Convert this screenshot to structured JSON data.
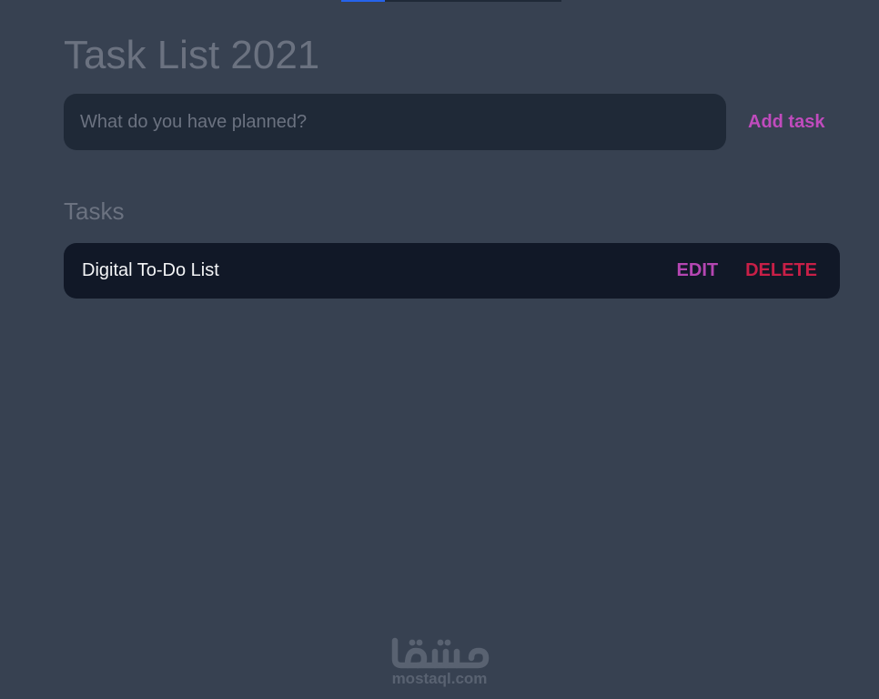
{
  "top_indicator": {
    "progress": 0.2
  },
  "header": {
    "title": "Task List 2021"
  },
  "new_task": {
    "placeholder": "What do you have planned?",
    "value": "",
    "add_label": "Add task"
  },
  "tasks": {
    "heading": "Tasks",
    "items": [
      {
        "text": "Digital To-Do List",
        "edit_label": "EDIT",
        "delete_label": "DELETE"
      }
    ]
  },
  "watermark": {
    "logo_text": "مستقل",
    "domain": "mostaql.com"
  },
  "colors": {
    "background": "#374151",
    "input_bg": "#1f2937",
    "task_bg": "#111827",
    "accent": "#c04bbd",
    "danger": "#c81f47",
    "muted_text": "#6b7280"
  }
}
